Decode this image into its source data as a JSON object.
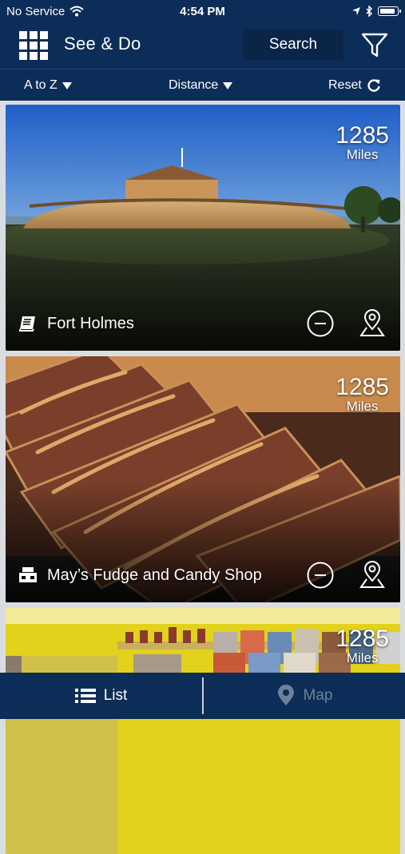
{
  "status_bar": {
    "carrier": "No Service",
    "time": "4:54 PM"
  },
  "header": {
    "title": "See & Do",
    "search_label": "Search"
  },
  "sort_bar": {
    "alpha_label": "A to Z",
    "distance_label": "Distance",
    "reset_label": "Reset"
  },
  "cards": [
    {
      "title": "Fort Holmes",
      "distance": "1285",
      "unit": "Miles",
      "type_icon": "book-icon"
    },
    {
      "title": "May’s Fudge and Candy Shop",
      "distance": "1285",
      "unit": "Miles",
      "type_icon": "shop-icon"
    },
    {
      "title": "",
      "distance": "1285",
      "unit": "Miles",
      "type_icon": ""
    }
  ],
  "tabs": {
    "list_label": "List",
    "map_label": "Map"
  },
  "colors": {
    "primary": "#0c2d57",
    "search_bg": "#0a2548",
    "inactive_tab": "#6d8299"
  }
}
